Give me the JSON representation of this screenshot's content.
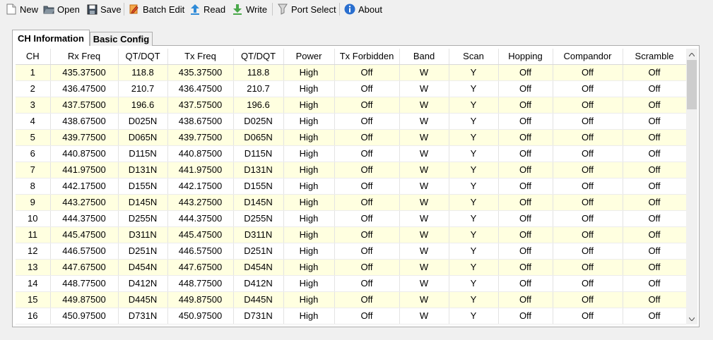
{
  "toolbar": {
    "new_label": "New",
    "open_label": "Open",
    "save_label": "Save",
    "batch_edit_label": "Batch Edit",
    "read_label": "Read",
    "write_label": "Write",
    "port_select_label": "Port Select",
    "about_label": "About"
  },
  "tabs": {
    "ch_information": "CH Information",
    "basic_config": "Basic Config"
  },
  "grid": {
    "columns": [
      "CH",
      "Rx Freq",
      "QT/DQT",
      "Tx Freq",
      "QT/DQT",
      "Power",
      "Tx Forbidden",
      "Band",
      "Scan",
      "Hopping",
      "Compandor",
      "Scramble"
    ],
    "rows": [
      [
        "1",
        "435.37500",
        "118.8",
        "435.37500",
        "118.8",
        "High",
        "Off",
        "W",
        "Y",
        "Off",
        "Off",
        "Off"
      ],
      [
        "2",
        "436.47500",
        "210.7",
        "436.47500",
        "210.7",
        "High",
        "Off",
        "W",
        "Y",
        "Off",
        "Off",
        "Off"
      ],
      [
        "3",
        "437.57500",
        "196.6",
        "437.57500",
        "196.6",
        "High",
        "Off",
        "W",
        "Y",
        "Off",
        "Off",
        "Off"
      ],
      [
        "4",
        "438.67500",
        "D025N",
        "438.67500",
        "D025N",
        "High",
        "Off",
        "W",
        "Y",
        "Off",
        "Off",
        "Off"
      ],
      [
        "5",
        "439.77500",
        "D065N",
        "439.77500",
        "D065N",
        "High",
        "Off",
        "W",
        "Y",
        "Off",
        "Off",
        "Off"
      ],
      [
        "6",
        "440.87500",
        "D115N",
        "440.87500",
        "D115N",
        "High",
        "Off",
        "W",
        "Y",
        "Off",
        "Off",
        "Off"
      ],
      [
        "7",
        "441.97500",
        "D131N",
        "441.97500",
        "D131N",
        "High",
        "Off",
        "W",
        "Y",
        "Off",
        "Off",
        "Off"
      ],
      [
        "8",
        "442.17500",
        "D155N",
        "442.17500",
        "D155N",
        "High",
        "Off",
        "W",
        "Y",
        "Off",
        "Off",
        "Off"
      ],
      [
        "9",
        "443.27500",
        "D145N",
        "443.27500",
        "D145N",
        "High",
        "Off",
        "W",
        "Y",
        "Off",
        "Off",
        "Off"
      ],
      [
        "10",
        "444.37500",
        "D255N",
        "444.37500",
        "D255N",
        "High",
        "Off",
        "W",
        "Y",
        "Off",
        "Off",
        "Off"
      ],
      [
        "11",
        "445.47500",
        "D311N",
        "445.47500",
        "D311N",
        "High",
        "Off",
        "W",
        "Y",
        "Off",
        "Off",
        "Off"
      ],
      [
        "12",
        "446.57500",
        "D251N",
        "446.57500",
        "D251N",
        "High",
        "Off",
        "W",
        "Y",
        "Off",
        "Off",
        "Off"
      ],
      [
        "13",
        "447.67500",
        "D454N",
        "447.67500",
        "D454N",
        "High",
        "Off",
        "W",
        "Y",
        "Off",
        "Off",
        "Off"
      ],
      [
        "14",
        "448.77500",
        "D412N",
        "448.77500",
        "D412N",
        "High",
        "Off",
        "W",
        "Y",
        "Off",
        "Off",
        "Off"
      ],
      [
        "15",
        "449.87500",
        "D445N",
        "449.87500",
        "D445N",
        "High",
        "Off",
        "W",
        "Y",
        "Off",
        "Off",
        "Off"
      ],
      [
        "16",
        "450.97500",
        "D731N",
        "450.97500",
        "D731N",
        "High",
        "Off",
        "W",
        "Y",
        "Off",
        "Off",
        "Off"
      ]
    ]
  },
  "colors": {
    "odd_row": "#ffffe0",
    "even_row": "#ffffff",
    "window_bg": "#f0f0f0"
  },
  "icons": {
    "new": "new-file-icon",
    "open": "open-folder-icon",
    "save": "save-icon",
    "batch_edit": "batch-edit-icon",
    "read": "read-arrow-up-icon",
    "write": "write-arrow-down-icon",
    "port_select": "port-select-icon",
    "about": "info-icon"
  }
}
